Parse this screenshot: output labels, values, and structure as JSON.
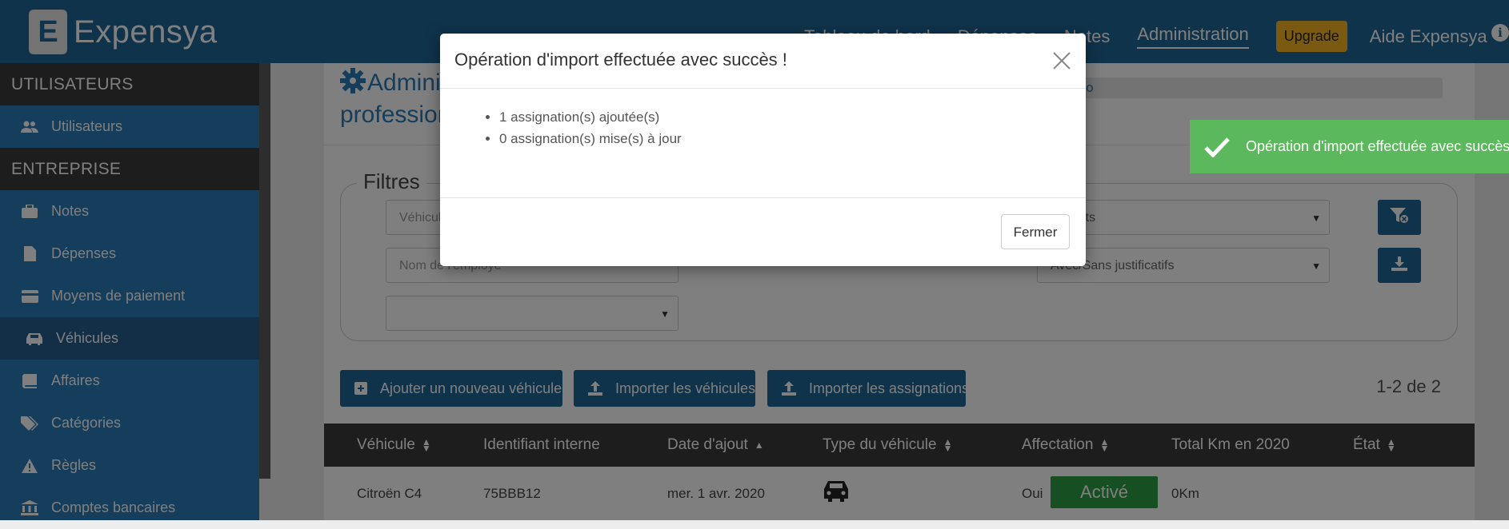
{
  "app": {
    "logo_letter": "E",
    "name": "Expensya"
  },
  "nav": {
    "items": [
      "Tableau de bord",
      "Dépenses",
      "Notes",
      "Administration"
    ],
    "upgrade": "Upgrade",
    "help": "Aide Expensya",
    "info_icon": "info-icon"
  },
  "sidebar": {
    "section_users": "UTILISATEURS",
    "users_item": {
      "label": "Utilisateurs",
      "icon": "users-icon"
    },
    "section_company": "ENTREPRISE",
    "items": [
      {
        "label": "Notes",
        "icon": "briefcase-icon"
      },
      {
        "label": "Dépenses",
        "icon": "document-icon"
      },
      {
        "label": "Moyens de paiement",
        "icon": "credit-card-icon"
      },
      {
        "label": "Véhicules",
        "icon": "car-icon",
        "active": true
      },
      {
        "label": "Affaires",
        "icon": "book-icon"
      },
      {
        "label": "Catégories",
        "icon": "tags-icon"
      },
      {
        "label": "Règles",
        "icon": "warning-icon"
      },
      {
        "label": "Comptes bancaires",
        "icon": "bank-icon"
      }
    ]
  },
  "page": {
    "title_line1": "Adminis",
    "title_line2": "profession",
    "pager_fragment": "o",
    "filters": {
      "legend": "Filtres",
      "vehicle_placeholder": "Véhicule",
      "state_select": "es états",
      "employee_placeholder": "Nom de l'employé",
      "receipt_select": "Avec/Sans justificatifs",
      "empty_select": ""
    },
    "actions": {
      "add": "Ajouter un nouveau véhicule",
      "import_vehicles": "Importer les véhicules",
      "import_assignments": "Importer les assignations"
    },
    "count": "1-2 de 2",
    "table": {
      "headers": [
        "Véhicule",
        "Identifiant interne",
        "Date d'ajout",
        "Type du véhicule",
        "Affectation",
        "Total Km en 2020",
        "État"
      ],
      "rows": [
        {
          "vehicle": "Citroën C4",
          "internal_id": "75BBB12",
          "date": "mer. 1 avr. 2020",
          "type_icon": "car-icon",
          "assignment": "Oui",
          "km": "0Km",
          "state": "Activé"
        }
      ]
    }
  },
  "toast": {
    "message": "Opération d'import effectuée avec succès !"
  },
  "modal": {
    "title": "Opération d'import effectuée avec succès !",
    "lines": [
      "1 assignation(s) ajoutée(s)",
      "0 assignation(s) mise(s) à jour"
    ],
    "close_button": "Fermer"
  },
  "colors": {
    "primary": "#1f6797",
    "sidebar": "#2a7ab8",
    "dark": "#3b3b3b",
    "upgrade": "#f5b520",
    "success": "#5cb85c",
    "active_badge": "#2c9f45"
  }
}
